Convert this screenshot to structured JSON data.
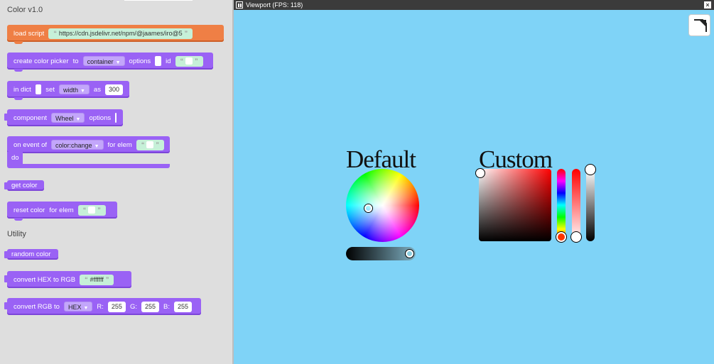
{
  "palette": {
    "category_title": "Color v1.0",
    "load_script": {
      "label": "load script",
      "url": "https://cdn.jsdelivr.net/npm/@jaames/iro@5"
    },
    "create_picker": {
      "label": "create color picker",
      "to": "to",
      "container": "container",
      "options": "options",
      "id": "id"
    },
    "in_dict": {
      "label": "in dict",
      "set": "set",
      "key": "width",
      "as": "as",
      "value": "300"
    },
    "component": {
      "label": "component",
      "type": "Wheel",
      "options": "options"
    },
    "on_event": {
      "label": "on event of",
      "event": "color:change",
      "for_elem": "for elem",
      "do": "do"
    },
    "get_color": {
      "label": "get color"
    },
    "reset_color": {
      "label": "reset color",
      "for_elem": "for elem"
    },
    "utility_title": "Utility",
    "random_color": {
      "label": "random color"
    },
    "hex_to_rgb": {
      "label": "convert HEX to RGB",
      "value": "#ffffff"
    },
    "rgb_to": {
      "label": "convert RGB to",
      "format": "HEX",
      "r_label": "R:",
      "r": "255",
      "g_label": "G:",
      "g": "255",
      "b_label": "B:",
      "b": "255"
    },
    "quote_open": "“",
    "quote_close": "”"
  },
  "viewport": {
    "title": "Viewport (FPS: 118)",
    "close": "×",
    "default_heading": "Default",
    "custom_heading": "Custom"
  },
  "colors": {
    "block_purple": "#9a62f5",
    "block_orange": "#ef7f45",
    "viewport_bg": "#7fd3f7",
    "titlebar": "#3b3b3b"
  },
  "icons": [
    "pause-icon",
    "close-icon",
    "expand-icon",
    "dropdown-caret-icon"
  ]
}
